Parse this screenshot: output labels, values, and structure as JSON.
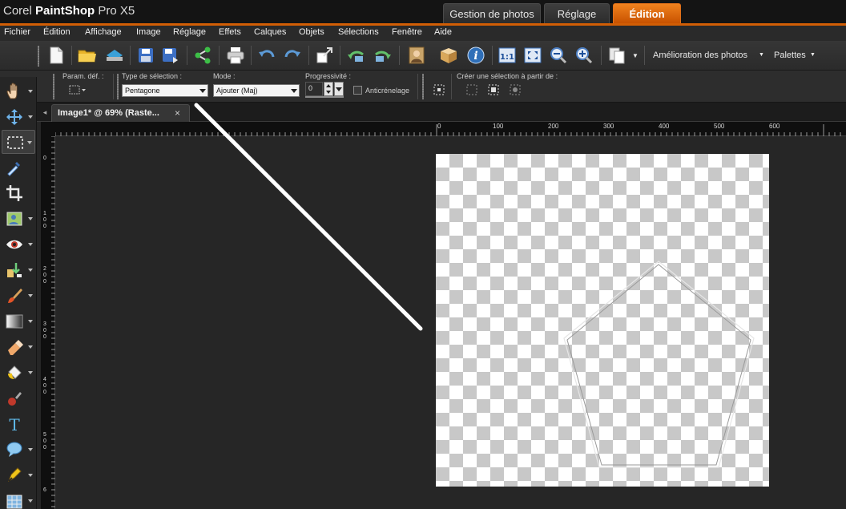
{
  "window": {
    "brand_light": "Corel ",
    "brand_bold": "PaintShop",
    "brand_suffix": " Pro X5",
    "workspace_tabs": [
      {
        "label": "Gestion de photos"
      },
      {
        "label": "Réglage"
      },
      {
        "label": "Édition",
        "active": true
      }
    ]
  },
  "menubar": {
    "items": [
      "Fichier",
      "Édition",
      "Affichage",
      "Image",
      "Réglage",
      "Effets",
      "Calques",
      "Objets",
      "Sélections",
      "Fenêtre",
      "Aide"
    ]
  },
  "toolbar": {
    "enhance_label": "Amélioration des photos",
    "palettes_label": "Palettes"
  },
  "options": {
    "presets_label": "Param. déf. :",
    "selection_type_label": "Type de sélection :",
    "selection_type_value": "Pentagone",
    "mode_label": "Mode :",
    "mode_value": "Ajouter (Maj)",
    "feather_label": "Progressivité :",
    "feather_value": "0",
    "antialias_label": "Anticrénelage",
    "create_from_label": "Créer une sélection à partir de :"
  },
  "document": {
    "tab_label": "Image1* @  69% (Raste...",
    "close_glyph": "×",
    "scroll_left_glyph": "◂",
    "hruler_labels": [
      "0",
      "100",
      "200",
      "300",
      "400",
      "500",
      "600"
    ],
    "vruler_labels": [
      "0",
      "1 0 0",
      "2 0 0",
      "3 0 0",
      "4 0 0",
      "5 0 0",
      "6"
    ]
  },
  "colors": {
    "accent": "#d25e05",
    "active_tab": "#e07415",
    "background": "#262626"
  }
}
